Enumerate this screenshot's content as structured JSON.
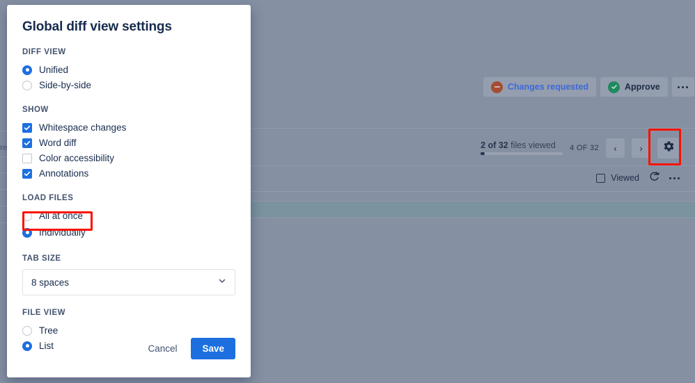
{
  "background": {
    "left_sliver_text": "re",
    "review_actions": {
      "changes_requested_label": "Changes requested",
      "changes_requested_icon": "minus-circle-icon",
      "approve_label": "Approve",
      "approve_icon": "check-circle-icon",
      "more_icon": "ellipsis-icon"
    },
    "files_toolbar": {
      "viewed_count": "2 of 32",
      "viewed_suffix": "files viewed",
      "file_counter": "4 OF 32",
      "prev_icon": "chevron-left-icon",
      "next_icon": "chevron-right-icon",
      "settings_icon": "gear-icon",
      "progress_percent": 6
    },
    "file_row": {
      "viewed_label": "Viewed",
      "refresh_icon": "refresh-plus-icon",
      "more_icon": "ellipsis-icon"
    },
    "colors": {
      "overlay": "#8690a3",
      "highlight_band": "#7a939e",
      "annotation_red": "#fc1100",
      "accent_blue": "#1d6fe0",
      "approve_green": "#1f8a5f",
      "changes_requested_brown": "#a54d34"
    }
  },
  "dialog": {
    "title": "Global diff view settings",
    "sections": [
      {
        "header": "DIFF VIEW",
        "type": "radio",
        "options": [
          {
            "label": "Unified",
            "checked": true
          },
          {
            "label": "Side-by-side",
            "checked": false
          }
        ]
      },
      {
        "header": "SHOW",
        "type": "checkbox",
        "options": [
          {
            "label": "Whitespace changes",
            "checked": true
          },
          {
            "label": "Word diff",
            "checked": true
          },
          {
            "label": "Color accessibility",
            "checked": false
          },
          {
            "label": "Annotations",
            "checked": true
          }
        ]
      },
      {
        "header": "LOAD FILES",
        "type": "radio",
        "options": [
          {
            "label": "All at once",
            "checked": false
          },
          {
            "label": "Individually",
            "checked": true,
            "highlighted": true
          }
        ]
      },
      {
        "header": "TAB SIZE",
        "type": "select",
        "value": "8 spaces",
        "chevron_icon": "chevron-down-icon"
      },
      {
        "header": "FILE VIEW",
        "type": "radio",
        "options": [
          {
            "label": "Tree",
            "checked": false
          },
          {
            "label": "List",
            "checked": true
          }
        ]
      }
    ],
    "footer": {
      "cancel_label": "Cancel",
      "save_label": "Save"
    }
  }
}
